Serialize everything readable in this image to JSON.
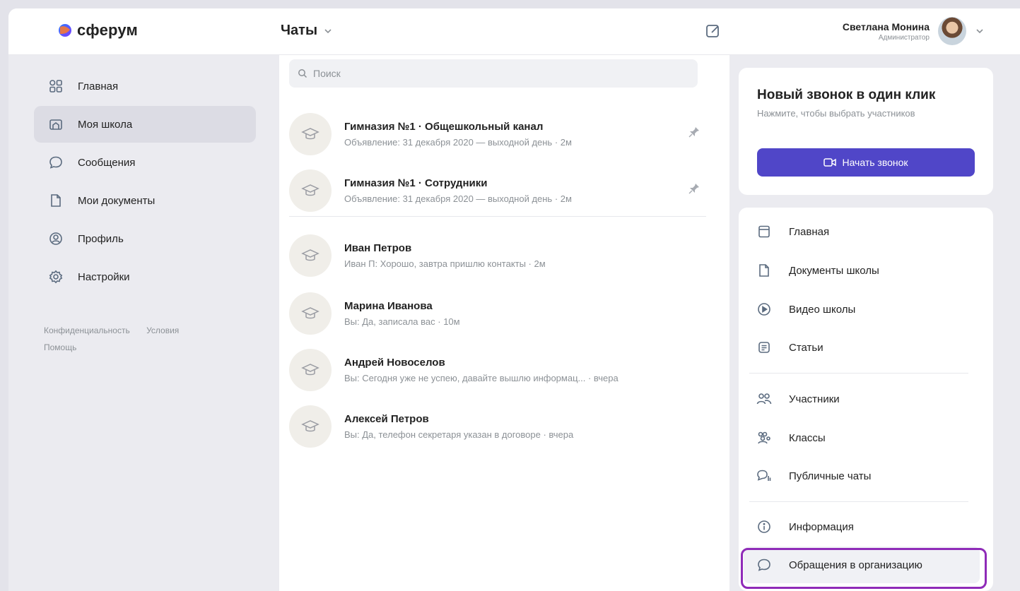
{
  "brand": {
    "name": "сферум"
  },
  "header": {
    "chats_title": "Чаты"
  },
  "user": {
    "name": "Светлана Монина",
    "role": "Администратор"
  },
  "sidebar": {
    "items": [
      {
        "label": "Главная",
        "icon": "home-grid-icon"
      },
      {
        "label": "Моя школа",
        "icon": "school-icon",
        "active": true
      },
      {
        "label": "Сообщения",
        "icon": "chat-bubble-icon"
      },
      {
        "label": "Мои документы",
        "icon": "document-icon"
      },
      {
        "label": "Профиль",
        "icon": "profile-icon"
      },
      {
        "label": "Настройки",
        "icon": "gear-icon"
      }
    ],
    "footer": {
      "privacy": "Конфиденциальность",
      "terms": "Условия",
      "help": "Помощь"
    }
  },
  "search": {
    "placeholder": "Поиск"
  },
  "chats": [
    {
      "name": "Гимназия №1 · Общешкольный канал",
      "preview": "Объявление: 31 декабря 2020 — выходной день · 2м",
      "pinned": true
    },
    {
      "name": "Гимназия №1 · Сотрудники",
      "preview": "Объявление: 31 декабря 2020 — выходной день · 2м",
      "pinned": true
    },
    {
      "name": "Иван Петров",
      "preview": "Иван П: Хорошо, завтра пришлю контакты · 2м",
      "pinned": false
    },
    {
      "name": "Марина Иванова",
      "preview": "Вы: Да, записала вас · 10м",
      "pinned": false
    },
    {
      "name": "Андрей Новоселов",
      "preview": "Вы: Сегодня уже не успею, давайте вышлю информац... · вчера",
      "pinned": false
    },
    {
      "name": "Алексей Петров",
      "preview": "Вы: Да, телефон секретаря указан в договоре · вчера",
      "pinned": false
    }
  ],
  "call": {
    "title": "Новый звонок в один клик",
    "subtitle": "Нажмите, чтобы выбрать участников",
    "button": "Начать звонок"
  },
  "right_menu": [
    {
      "label": "Главная",
      "icon": "home-icon"
    },
    {
      "label": "Документы школы",
      "icon": "document-icon"
    },
    {
      "label": "Видео школы",
      "icon": "play-icon"
    },
    {
      "label": "Статьи",
      "icon": "article-icon"
    },
    {
      "label": "Участники",
      "icon": "users-icon"
    },
    {
      "label": "Классы",
      "icon": "group-icon"
    },
    {
      "label": "Публичные чаты",
      "icon": "public-chat-icon"
    },
    {
      "label": "Информация",
      "icon": "info-icon"
    },
    {
      "label": "Обращения в организацию",
      "icon": "chat-bubble-icon",
      "highlighted": true
    }
  ],
  "colors": {
    "accent": "#5046c8",
    "highlight": "#8f2bb8",
    "muted": "#8c9196"
  }
}
